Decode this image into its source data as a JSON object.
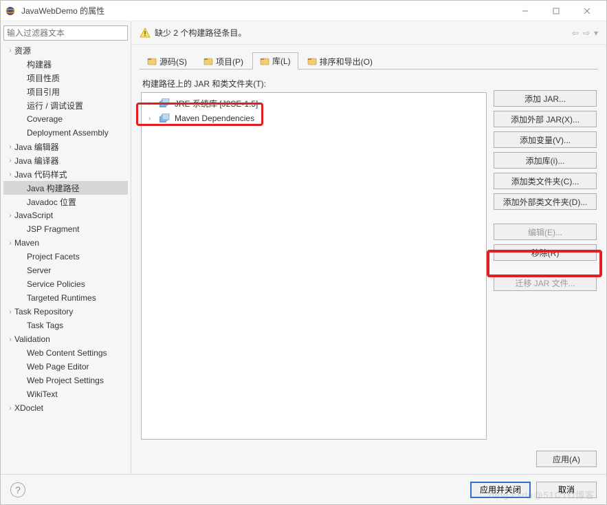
{
  "window": {
    "title": "JavaWebDemo 的属性"
  },
  "sidebar": {
    "filter_placeholder": "输入过滤器文本",
    "items": [
      {
        "label": "资源",
        "expandable": true,
        "level": 0
      },
      {
        "label": "构建器",
        "level": 1
      },
      {
        "label": "项目性质",
        "level": 1
      },
      {
        "label": "项目引用",
        "level": 1
      },
      {
        "label": "运行 / 调试设置",
        "level": 1
      },
      {
        "label": "Coverage",
        "level": 1
      },
      {
        "label": "Deployment Assembly",
        "level": 1
      },
      {
        "label": "Java 编辑器",
        "expandable": true,
        "level": 0
      },
      {
        "label": "Java 编译器",
        "expandable": true,
        "level": 0
      },
      {
        "label": "Java 代码样式",
        "expandable": true,
        "level": 0
      },
      {
        "label": "Java 构建路径",
        "level": 1,
        "selected": true
      },
      {
        "label": "Javadoc 位置",
        "level": 1
      },
      {
        "label": "JavaScript",
        "expandable": true,
        "level": 0
      },
      {
        "label": "JSP Fragment",
        "level": 1
      },
      {
        "label": "Maven",
        "expandable": true,
        "level": 0
      },
      {
        "label": "Project Facets",
        "level": 1
      },
      {
        "label": "Server",
        "level": 1
      },
      {
        "label": "Service Policies",
        "level": 1
      },
      {
        "label": "Targeted Runtimes",
        "level": 1
      },
      {
        "label": "Task Repository",
        "expandable": true,
        "level": 0
      },
      {
        "label": "Task Tags",
        "level": 1
      },
      {
        "label": "Validation",
        "expandable": true,
        "level": 0
      },
      {
        "label": "Web Content Settings",
        "level": 1
      },
      {
        "label": "Web Page Editor",
        "level": 1
      },
      {
        "label": "Web Project Settings",
        "level": 1
      },
      {
        "label": "WikiText",
        "level": 1
      },
      {
        "label": "XDoclet",
        "expandable": true,
        "level": 0
      }
    ]
  },
  "warning": {
    "text": "缺少 2 个构建路径条目。"
  },
  "tabs": [
    {
      "label": "源码(S)",
      "icon": "folder-source-icon"
    },
    {
      "label": "项目(P)",
      "icon": "projects-icon"
    },
    {
      "label": "库(L)",
      "icon": "library-icon",
      "active": true
    },
    {
      "label": "排序和导出(O)",
      "icon": "order-icon"
    }
  ],
  "listbox": {
    "section_label": "构建路径上的 JAR 和类文件夹(T):",
    "items": [
      {
        "name": "JRE 系统库 [J2SE-1.5]"
      },
      {
        "name": "Maven Dependencies"
      }
    ]
  },
  "buttons": {
    "add_jar": "添加 JAR...",
    "add_external_jar": "添加外部 JAR(X)...",
    "add_variable": "添加变量(V)...",
    "add_library": "添加库(i)...",
    "add_class_folder": "添加类文件夹(C)...",
    "add_external_class_folder": "添加外部类文件夹(D)...",
    "edit": "编辑(E)...",
    "remove": "移除(R)",
    "migrate": "迁移 JAR 文件..."
  },
  "footer": {
    "apply": "应用(A)",
    "apply_close": "应用并关闭",
    "cancel": "取消"
  },
  "watermark": "blog.csdn@51CTO博客"
}
